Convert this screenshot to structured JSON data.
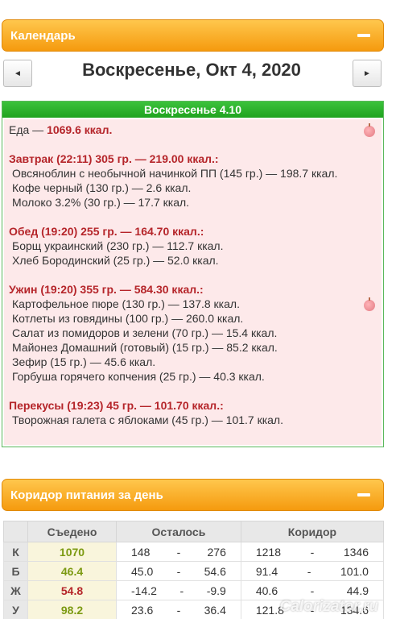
{
  "calendar": {
    "title": "Календарь",
    "prev_label": "◄",
    "next_label": "►",
    "date": "Воскресенье, Окт 4, 2020"
  },
  "diary": {
    "day_label": "Воскресенье 4.10",
    "food_total_label": "Еда —",
    "food_total_value": "1069.6 ккал.",
    "meals": [
      {
        "title": "Завтрак (22:11) 305 гр. — 219.00 ккал.:",
        "items": [
          "Овсяноблин с необычной начинкой ПП (145 гр.) — 198.7 ккал.",
          "Кофе черный (130 гр.) — 2.6 ккал.",
          "Молоко 3.2% (30 гр.) — 17.7 ккал."
        ]
      },
      {
        "title": "Обед (19:20) 255 гр. — 164.70 ккал.:",
        "items": [
          "Борщ украинский (230 гр.) — 112.7 ккал.",
          "Хлеб Бородинский (25 гр.) — 52.0 ккал."
        ]
      },
      {
        "title": "Ужин (19:20) 355 гр. — 584.30 ккал.:",
        "items": [
          "Картофельное пюре (130 гр.) — 137.8 ккал.",
          "Котлеты из говядины (100 гр.) — 260.0 ккал.",
          "Салат из помидоров и зелени (70 гр.) — 15.4 ккал.",
          "Майонез Домашний (готовый) (15 гр.) — 85.2 ккал.",
          "Зефир (15 гр.) — 45.6 ккал.",
          "Горбуша горячего копчения (25 гр.) — 40.3 ккал."
        ]
      },
      {
        "title": "Перекусы (19:23) 45 гр. — 101.70 ккал.:",
        "items": [
          "Творожная галета с яблоками (45 гр.) — 101.7 ккал."
        ]
      }
    ]
  },
  "corridor": {
    "title": "Коридор питания за день",
    "headers": [
      "",
      "Съедено",
      "Осталось",
      "Коридор"
    ],
    "separator": "-",
    "rows": [
      {
        "key": "К",
        "eaten": "1070",
        "eaten_color": "#7c9a12",
        "left_from": "148",
        "left_to": "276",
        "corr_from": "1218",
        "corr_to": "1346"
      },
      {
        "key": "Б",
        "eaten": "46.4",
        "eaten_color": "#7c9a12",
        "left_from": "45.0",
        "left_to": "54.6",
        "corr_from": "91.4",
        "corr_to": "101.0"
      },
      {
        "key": "Ж",
        "eaten": "54.8",
        "eaten_color": "#b5252a",
        "left_from": "-14.2",
        "left_to": "-9.9",
        "corr_from": "40.6",
        "corr_to": "44.9"
      },
      {
        "key": "У",
        "eaten": "98.2",
        "eaten_color": "#7c9a12",
        "left_from": "23.6",
        "left_to": "36.4",
        "corr_from": "121.8",
        "corr_to": "134.6"
      }
    ]
  },
  "watermark": "Calorizator.ru",
  "colors": {
    "header_orange": "#f59a0e",
    "day_green": "#1fa31f",
    "meal_red": "#b5252a",
    "diary_bg": "#fde9ea"
  }
}
